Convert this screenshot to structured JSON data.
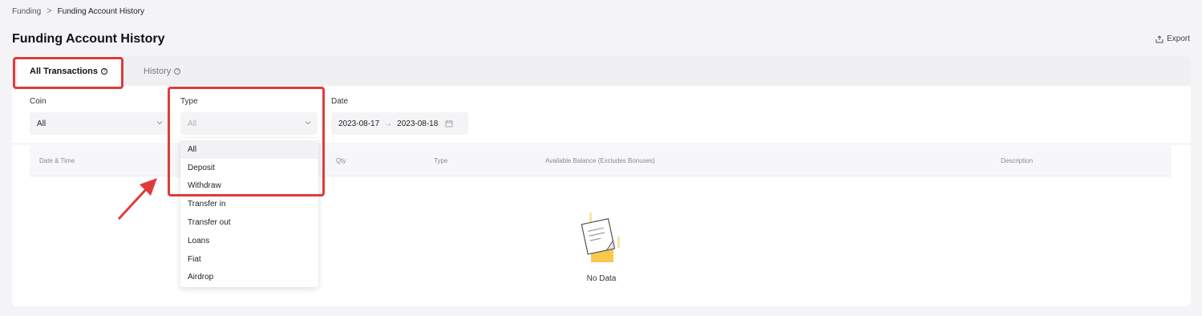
{
  "breadcrumb": {
    "parent": "Funding",
    "separator": ">",
    "current": "Funding Account History"
  },
  "header": {
    "title": "Funding Account History",
    "export_label": "Export"
  },
  "tabs": [
    {
      "label": "All Transactions",
      "active": true
    },
    {
      "label": "History",
      "active": false
    }
  ],
  "filters": {
    "coin": {
      "label": "Coin",
      "value": "All"
    },
    "type": {
      "label": "Type",
      "value": "All"
    },
    "date": {
      "label": "Date",
      "from": "2023-08-17",
      "arrow": "→",
      "to": "2023-08-18"
    }
  },
  "table": {
    "columns": [
      "Date & Time",
      "Qty",
      "Type",
      "Available Balance (Excludes Bonuses)",
      "Description"
    ],
    "empty_text": "No Data"
  },
  "type_dropdown": {
    "options": [
      "All",
      "Deposit",
      "Withdraw",
      "Transfer in",
      "Transfer out",
      "Loans",
      "Fiat",
      "Airdrop"
    ],
    "selected": "All"
  },
  "colors": {
    "annotation": "#e03b3b",
    "accent": "#f7a600",
    "background": "#f4f4f6"
  }
}
